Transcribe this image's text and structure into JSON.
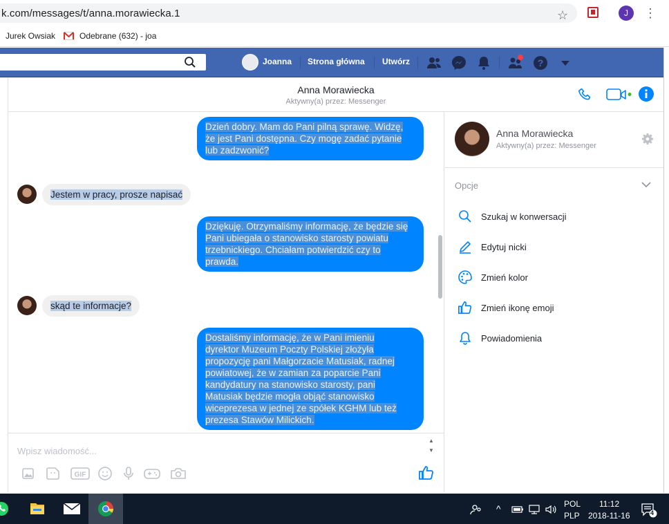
{
  "browser": {
    "url": "k.com/messages/t/anna.morawiecka.1",
    "profile_initial": "J",
    "bookmarks": [
      {
        "label": "Jurek Owsiak"
      },
      {
        "label": "Odebrane (632) - joa"
      }
    ]
  },
  "facebook": {
    "user_name": "Joanna",
    "nav": [
      "Strona główna",
      "Utwórz"
    ],
    "brand_color": "#4267b2"
  },
  "chat": {
    "contact_name": "Anna Morawiecka",
    "contact_status": "Aktywny(a) przez: Messenger",
    "messages": [
      {
        "direction": "outgoing",
        "lines": [
          "Dzień dobry. Mam do Pani pilną sprawę. Widzę,",
          "że jest Pani dostępna. Czy mogę zadać pytanie",
          "lub zadzwonić?"
        ]
      },
      {
        "direction": "incoming",
        "lines": [
          "Jestem w pracy, prosze napisać"
        ]
      },
      {
        "direction": "outgoing",
        "lines": [
          "Dziękuję. Otrzymaliśmy informację, że będzie się",
          "Pani ubiegała o stanowisko starosty powiatu",
          "trzebnickiego. Chciałam potwierdzić czy to",
          "prawda."
        ]
      },
      {
        "direction": "incoming",
        "lines": [
          "skąd te informacje?"
        ]
      },
      {
        "direction": "outgoing",
        "lines": [
          "Dostaliśmy informację, że w Pani imieniu",
          "dyrektor Muzeum Poczty Polskiej złożyła",
          "propozycję pani Małgorzacie Matusiak, radnej",
          "powiatowej, że w zamian za poparcie Pani",
          "kandydatury na stanowisko starosty, pani",
          "Matusiak będzie mogła objąć stanowisko",
          "wiceprezesa w jednej ze spółek KGHM lub też",
          "prezesa Stawów Milickich."
        ]
      }
    ],
    "composer_placeholder": "Wpisz wiadomość...",
    "accent_color": "#0084ff"
  },
  "info_panel": {
    "contact_name": "Anna Morawiecka",
    "contact_status": "Aktywny(a) przez: Messenger",
    "options_title": "Opcje",
    "options": [
      {
        "label": "Szukaj w konwersacji",
        "icon": "search-icon"
      },
      {
        "label": "Edytuj nicki",
        "icon": "pencil-icon"
      },
      {
        "label": "Zmień kolor",
        "icon": "palette-icon"
      },
      {
        "label": "Zmień ikonę emoji",
        "icon": "thumbs-up-icon"
      },
      {
        "label": "Powiadomienia",
        "icon": "bell-icon"
      }
    ]
  },
  "taskbar": {
    "lang_top": "POL",
    "lang_bottom": "PLP",
    "time": "11:12",
    "date": "2018-11-16",
    "notification_count": "4"
  }
}
